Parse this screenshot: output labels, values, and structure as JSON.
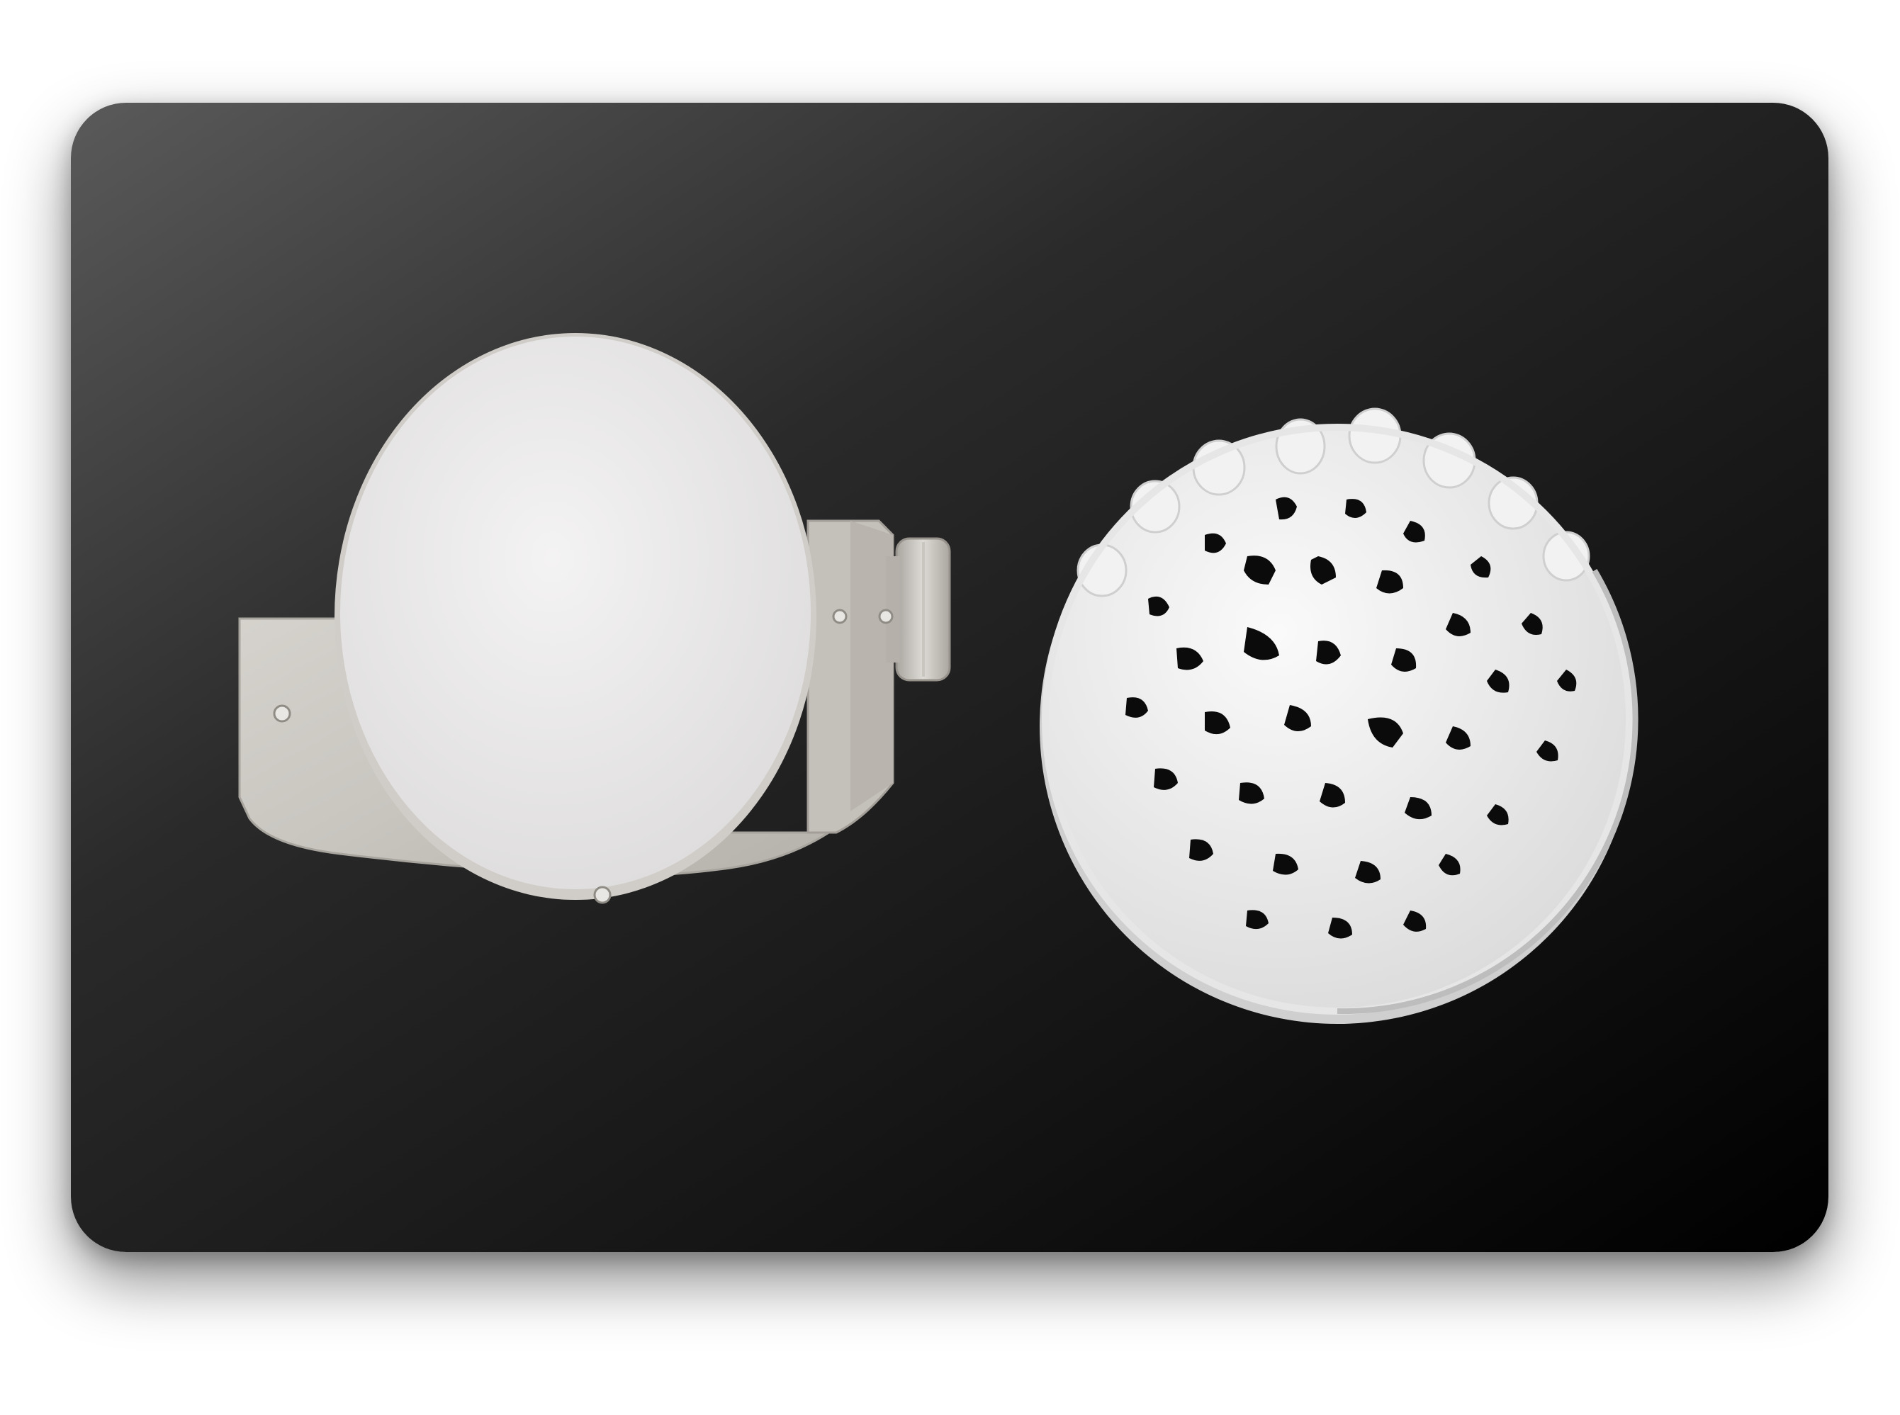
{
  "scene": {
    "description_colors": {
      "card_gradient_start": "#555555",
      "card_gradient_mid": "#202020",
      "card_gradient_end": "#000000",
      "blank_disc": "#ecebeb",
      "holder_metal": "#cfccc7",
      "milled_disc": "#f3f3f3",
      "cutout": "#0b0b0b"
    },
    "icons": [
      "zirconia-blank-icon",
      "disc-holder-icon",
      "milled-disc-icon"
    ]
  }
}
